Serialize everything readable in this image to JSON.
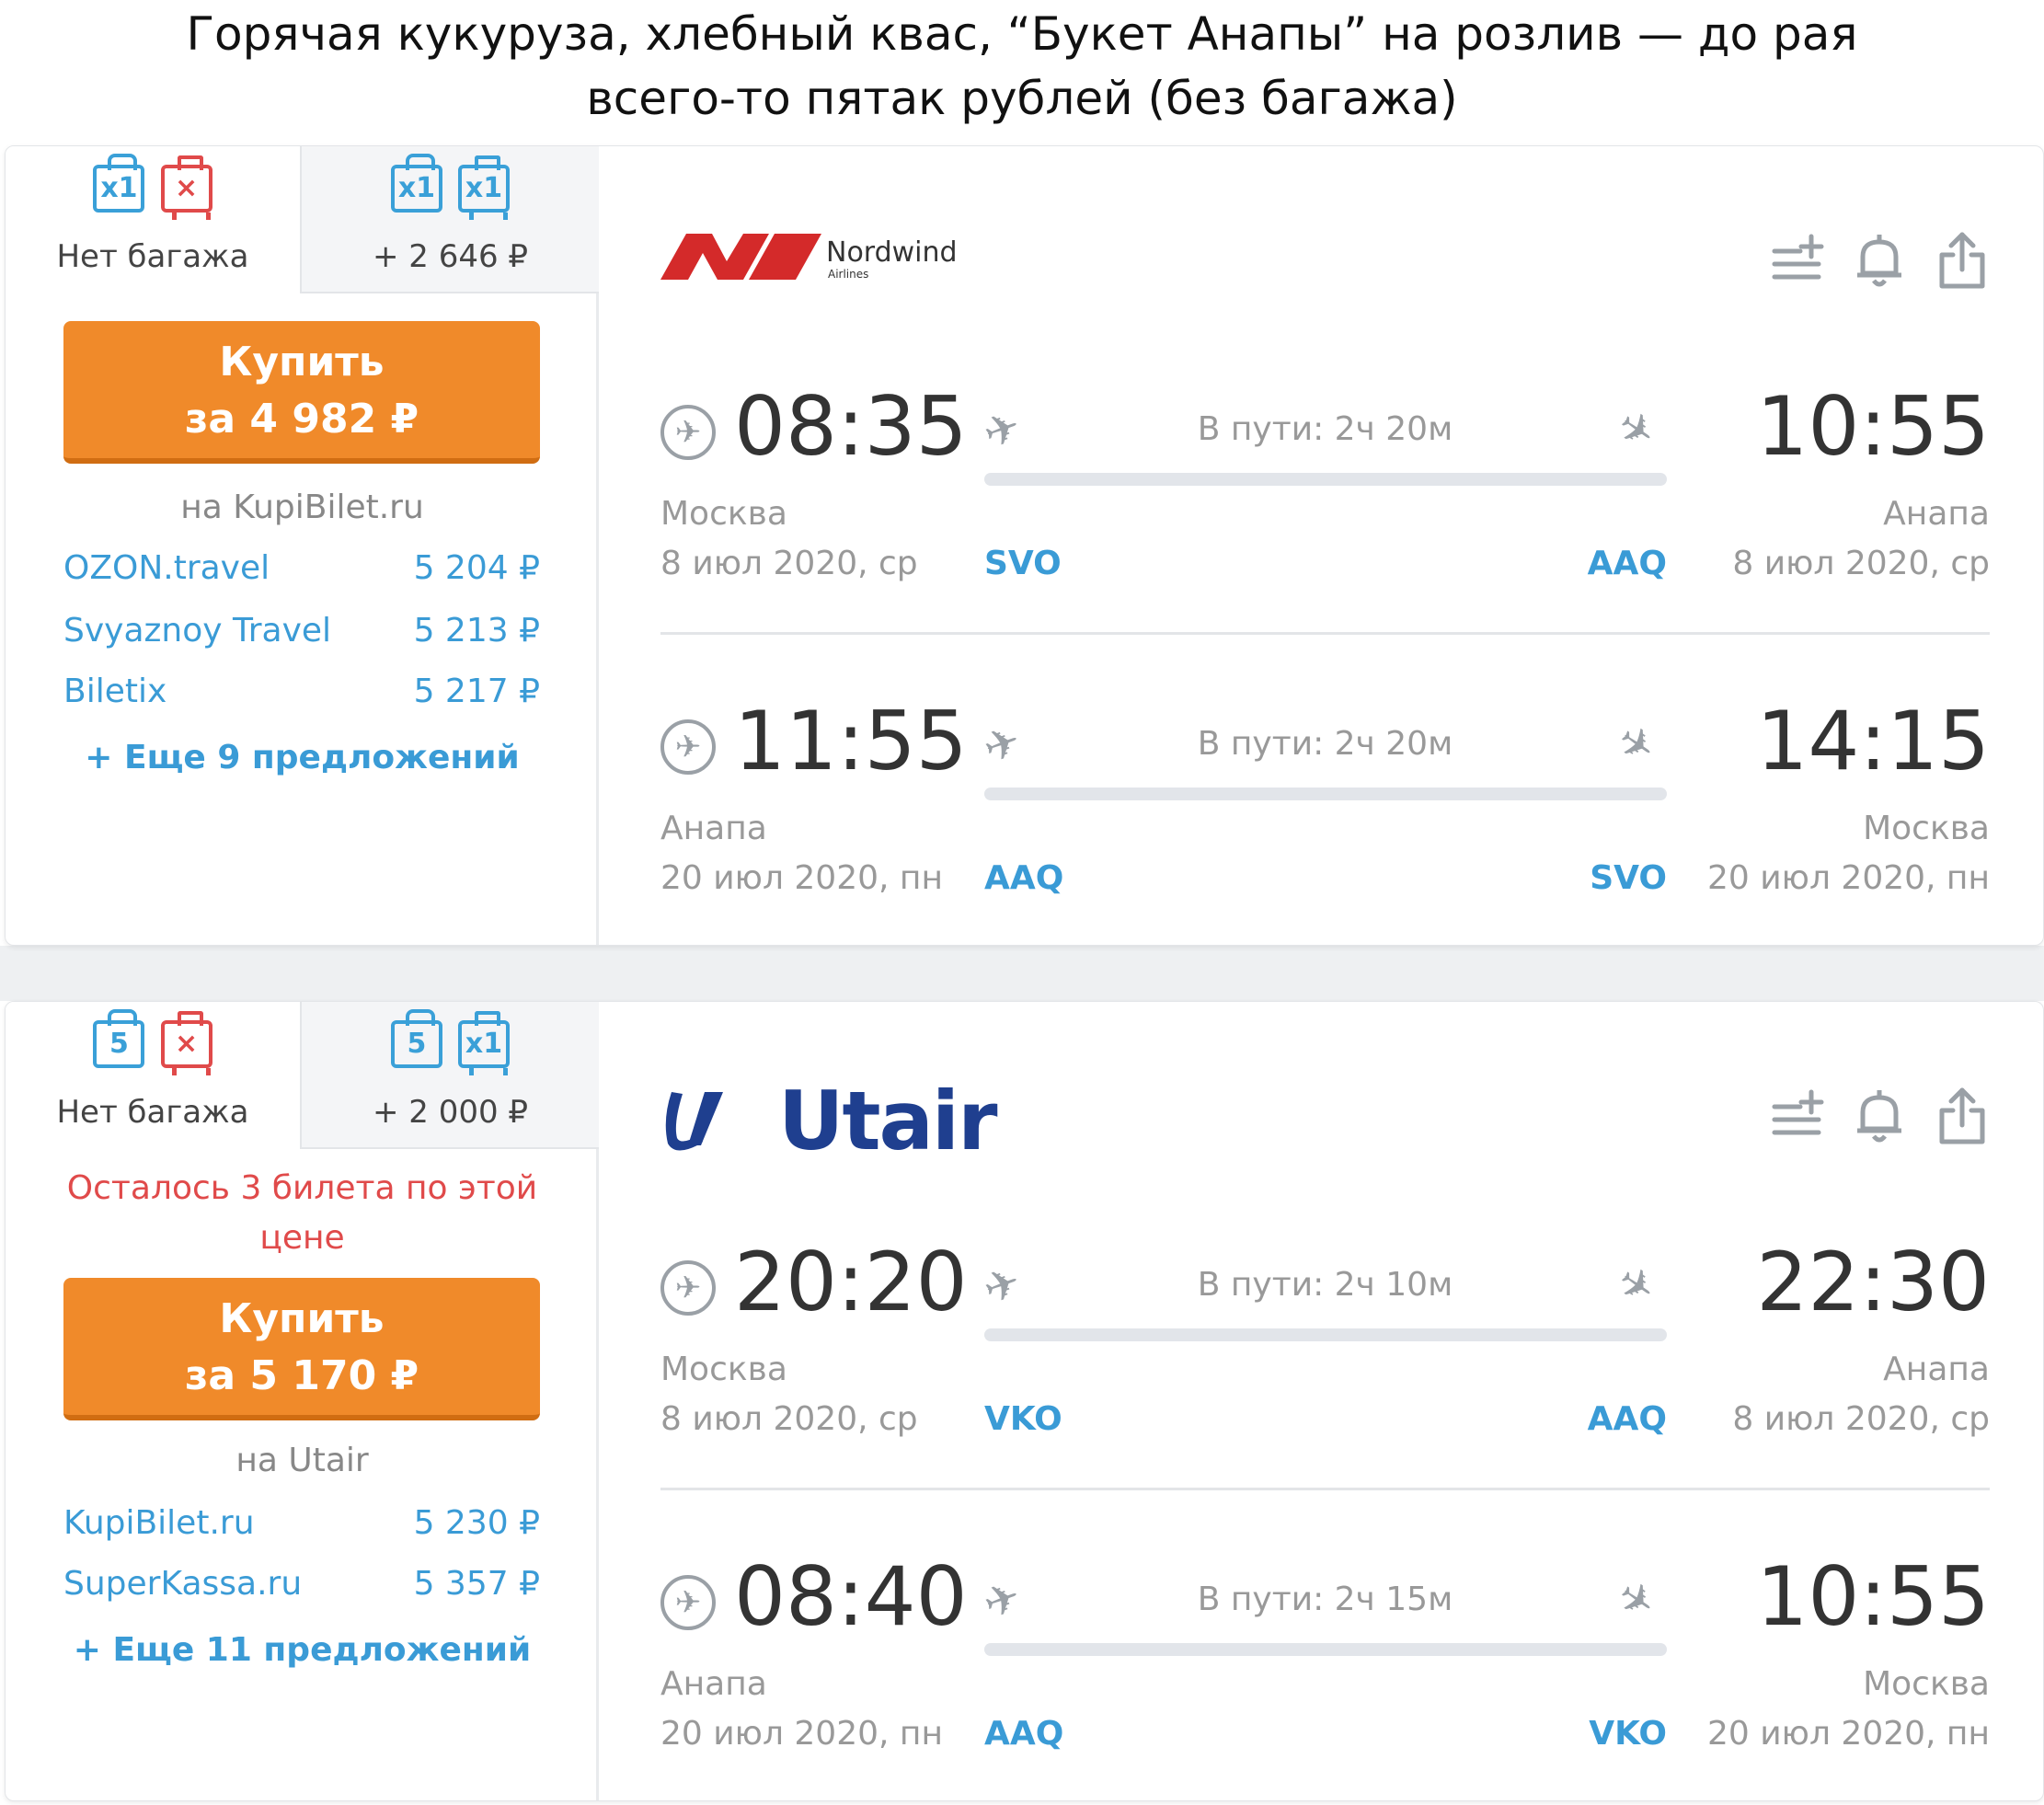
{
  "caption": {
    "line1": "Горячая кукуруза, хлебный квас, “Букет Анапы” на розлив — до рая",
    "line2": "всего-то пятак рублей (без багажа)"
  },
  "colors": {
    "accent": "#f08a2a",
    "link": "#3a9bd6",
    "warning": "#e04a4a",
    "muted": "#999999"
  },
  "card1": {
    "airline": {
      "name": "Nordwind",
      "sub": "Airlines"
    },
    "tabs": [
      {
        "icons": [
          "x1",
          "×"
        ],
        "label": "Нет багажа"
      },
      {
        "icons": [
          "x1",
          "x1"
        ],
        "label": "+ 2 646 ₽"
      }
    ],
    "buy": {
      "line1": "Купить",
      "line2": "за 4 982 ₽"
    },
    "via": "на KupiBilet.ru",
    "offers": [
      {
        "name": "OZON.travel",
        "price": "5 204 ₽"
      },
      {
        "name": "Svyaznoy Travel",
        "price": "5 213 ₽"
      },
      {
        "name": "Biletix",
        "price": "5 217 ₽"
      }
    ],
    "more": "+ Еще 9 предложений",
    "segments": [
      {
        "dep_time": "08:35",
        "arr_time": "10:55",
        "duration": "В пути: 2ч 20м",
        "dep_city": "Москва",
        "dep_date": "8 июл 2020, ср",
        "dep_code": "SVO",
        "arr_code": "AAQ",
        "arr_city": "Анапа",
        "arr_date": "8 июл 2020, ср"
      },
      {
        "dep_time": "11:55",
        "arr_time": "14:15",
        "duration": "В пути: 2ч 20м",
        "dep_city": "Анапа",
        "dep_date": "20 июл 2020, пн",
        "dep_code": "AAQ",
        "arr_code": "SVO",
        "arr_city": "Москва",
        "arr_date": "20 июл 2020, пн"
      }
    ]
  },
  "card2": {
    "airline": {
      "name": "Utair"
    },
    "tabs": [
      {
        "icons": [
          "5",
          "×"
        ],
        "label": "Нет багажа"
      },
      {
        "icons": [
          "5",
          "x1"
        ],
        "label": "+ 2 000 ₽"
      }
    ],
    "warning_line1": "Осталось 3 билета по этой",
    "warning_line2": "цене",
    "buy": {
      "line1": "Купить",
      "line2": "за 5 170 ₽"
    },
    "via": "на Utair",
    "offers": [
      {
        "name": "KupiBilet.ru",
        "price": "5 230 ₽"
      },
      {
        "name": "SuperKassa.ru",
        "price": "5 357 ₽"
      }
    ],
    "more": "+ Еще 11 предложений",
    "segments": [
      {
        "dep_time": "20:20",
        "arr_time": "22:30",
        "duration": "В пути: 2ч 10м",
        "dep_city": "Москва",
        "dep_date": "8 июл 2020, ср",
        "dep_code": "VKO",
        "arr_code": "AAQ",
        "arr_city": "Анапа",
        "arr_date": "8 июл 2020, ср"
      },
      {
        "dep_time": "08:40",
        "arr_time": "10:55",
        "duration": "В пути: 2ч 15м",
        "dep_city": "Анапа",
        "dep_date": "20 июл 2020, пн",
        "dep_code": "AAQ",
        "arr_code": "VKO",
        "arr_city": "Москва",
        "arr_date": "20 июл 2020, пн"
      }
    ]
  },
  "icons": {
    "pin": "pin-icon",
    "plane_up": "plane-takeoff-icon",
    "plane_down": "plane-landing-icon",
    "compare": "add-to-list-icon",
    "bell": "bell-icon",
    "share": "share-icon",
    "bag": "hand-luggage-icon",
    "suitcase": "suitcase-icon"
  }
}
